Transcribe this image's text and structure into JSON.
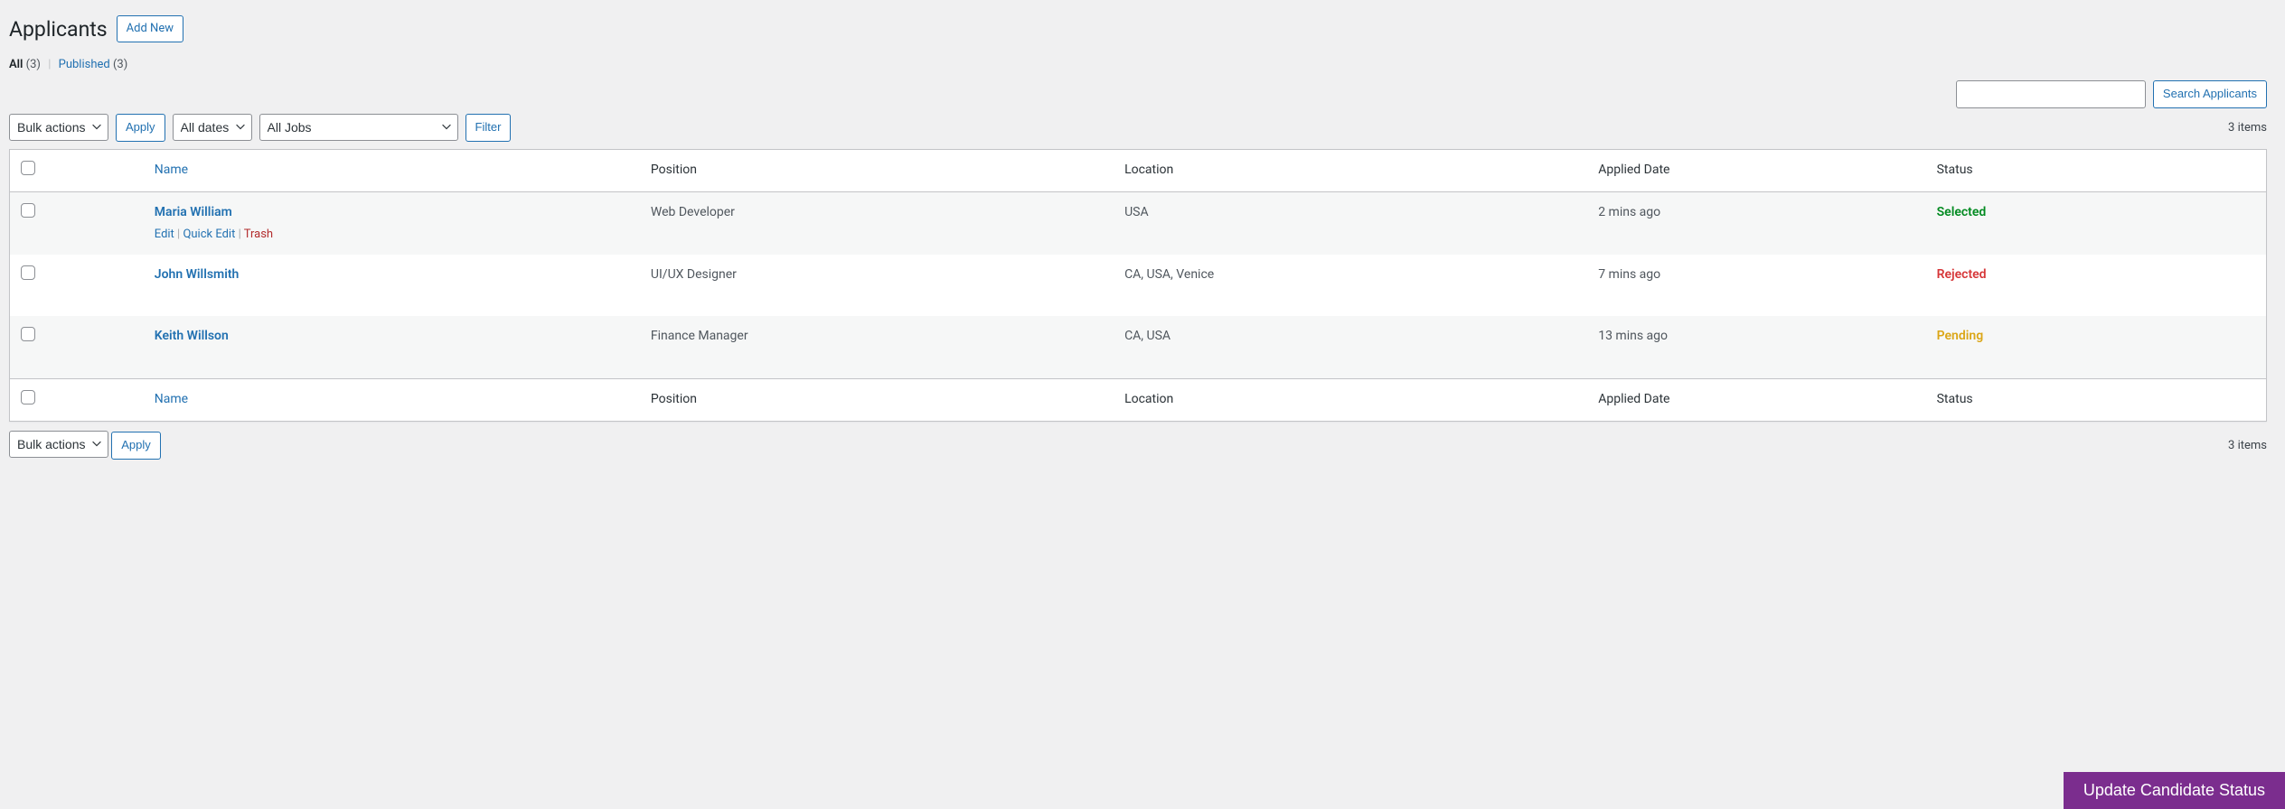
{
  "page": {
    "heading": "Applicants",
    "add_new": "Add New"
  },
  "filters": {
    "all_label": "All",
    "all_count": "(3)",
    "published_label": "Published",
    "published_count": "(3)"
  },
  "search": {
    "button": "Search Applicants"
  },
  "tablenav": {
    "bulk_actions": "Bulk actions",
    "apply": "Apply",
    "all_dates": "All dates",
    "all_jobs": "All Jobs",
    "filter": "Filter",
    "items_text": "3 items"
  },
  "columns": {
    "name": "Name",
    "position": "Position",
    "location": "Location",
    "applied_date": "Applied Date",
    "status": "Status"
  },
  "row_actions": {
    "edit": "Edit",
    "quick_edit": "Quick Edit",
    "trash": "Trash"
  },
  "rows": [
    {
      "name": "Maria William",
      "position": "Web Developer",
      "location": "USA",
      "applied": "2 mins ago",
      "status": "Selected",
      "status_class": "status-selected"
    },
    {
      "name": "John Willsmith",
      "position": "UI/UX Designer",
      "location": "CA, USA, Venice",
      "applied": "7 mins ago",
      "status": "Rejected",
      "status_class": "status-rejected"
    },
    {
      "name": "Keith Willson",
      "position": "Finance Manager",
      "location": "CA, USA",
      "applied": "13 mins ago",
      "status": "Pending",
      "status_class": "status-pending"
    }
  ],
  "footer_button": "Update Candidate Status"
}
